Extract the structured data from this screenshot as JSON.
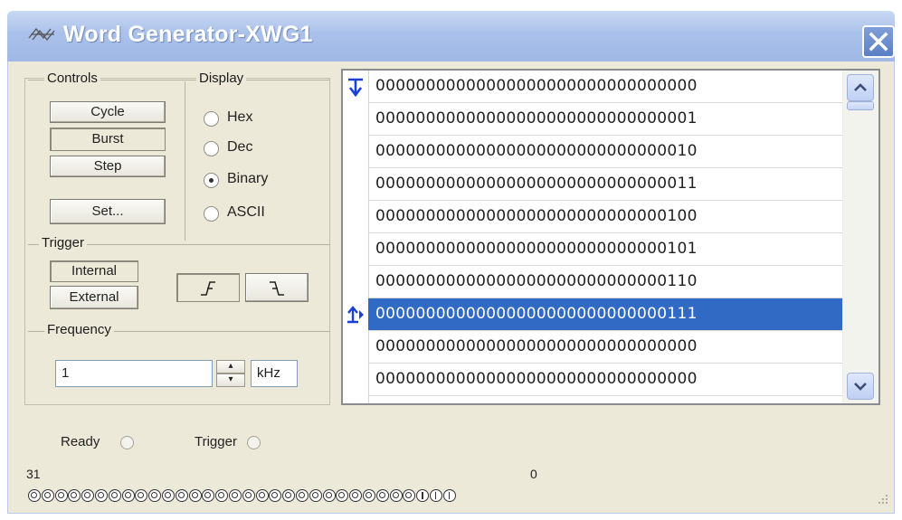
{
  "window": {
    "title": "Word Generator-XWG1"
  },
  "controls": {
    "legend": "Controls",
    "cycle": "Cycle",
    "burst": "Burst",
    "step": "Step",
    "set": "Set..."
  },
  "display": {
    "legend": "Display",
    "options": [
      "Hex",
      "Dec",
      "Binary",
      "ASCII"
    ],
    "selected": "Binary"
  },
  "trigger": {
    "legend": "Trigger",
    "internal": "Internal",
    "external": "External",
    "rising_symbol": "⊥",
    "falling_symbol": "⊤"
  },
  "frequency": {
    "legend": "Frequency",
    "value": "1",
    "unit": "kHz"
  },
  "words": [
    "00000000000000000000000000000000",
    "00000000000000000000000000000001",
    "00000000000000000000000000000010",
    "00000000000000000000000000000011",
    "00000000000000000000000000000100",
    "00000000000000000000000000000101",
    "00000000000000000000000000000110",
    "00000000000000000000000000000111",
    "00000000000000000000000000000000",
    "00000000000000000000000000000000"
  ],
  "selected_row": 7,
  "status": {
    "ready": "Ready",
    "trigger": "Trigger"
  },
  "bits": {
    "high_label": "31",
    "low_label": "0",
    "values": "00000000000000000000000000000111"
  },
  "colors": {
    "selection": "#316ac5",
    "titlebar": "#a9c1ea",
    "marker": "#1c3fd6"
  }
}
